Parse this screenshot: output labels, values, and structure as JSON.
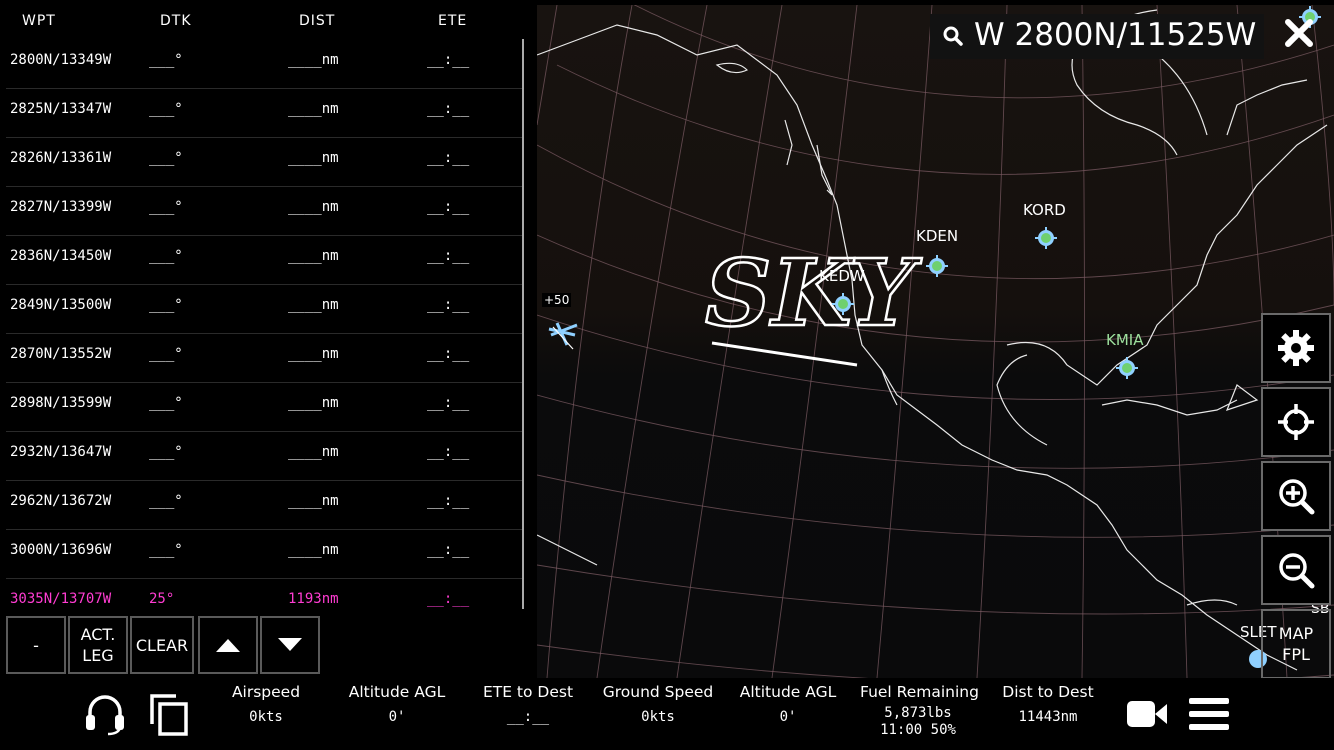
{
  "flight_plan": {
    "headers": {
      "wpt": "WPT",
      "dtk": "DTK",
      "dist": "DIST",
      "ete": "ETE"
    },
    "rows": [
      {
        "wpt": "2800N/13349W",
        "dtk": "___°",
        "dist": "____nm",
        "ete": "__:__"
      },
      {
        "wpt": "2825N/13347W",
        "dtk": "___°",
        "dist": "____nm",
        "ete": "__:__"
      },
      {
        "wpt": "2826N/13361W",
        "dtk": "___°",
        "dist": "____nm",
        "ete": "__:__"
      },
      {
        "wpt": "2827N/13399W",
        "dtk": "___°",
        "dist": "____nm",
        "ete": "__:__"
      },
      {
        "wpt": "2836N/13450W",
        "dtk": "___°",
        "dist": "____nm",
        "ete": "__:__"
      },
      {
        "wpt": "2849N/13500W",
        "dtk": "___°",
        "dist": "____nm",
        "ete": "__:__"
      },
      {
        "wpt": "2870N/13552W",
        "dtk": "___°",
        "dist": "____nm",
        "ete": "__:__"
      },
      {
        "wpt": "2898N/13599W",
        "dtk": "___°",
        "dist": "____nm",
        "ete": "__:__"
      },
      {
        "wpt": "2932N/13647W",
        "dtk": "___°",
        "dist": "____nm",
        "ete": "__:__"
      },
      {
        "wpt": "2962N/13672W",
        "dtk": "___°",
        "dist": "____nm",
        "ete": "__:__"
      },
      {
        "wpt": "3000N/13696W",
        "dtk": "___°",
        "dist": "____nm",
        "ete": "__:__"
      },
      {
        "wpt": "3035N/13707W",
        "dtk": "25°",
        "dist": "1193nm",
        "ete": "__:__"
      }
    ],
    "active_color": "#ff3cd2",
    "buttons": {
      "minus": "-",
      "act_leg_1": "ACT.",
      "act_leg_2": "LEG",
      "clear": "CLEAR",
      "up_icon": "triangle-up-icon",
      "down_icon": "triangle-down-icon"
    }
  },
  "map": {
    "search_text": "W 2800N/11525W",
    "airports": {
      "kden": "KDEN",
      "kord": "KORD",
      "kmia": "KMIA",
      "kedw": "KEDW",
      "slet": "SLET",
      "sb": "SB"
    },
    "aircraft_label": "+50",
    "marker_color": "#8fd0ff",
    "kmia_color": "#9de09d",
    "watermark": "SKY"
  },
  "side_buttons": {
    "settings_icon": "gear-icon",
    "center_icon": "crosshair-icon",
    "zoom_in_icon": "zoom-in-icon",
    "zoom_out_icon": "zoom-out-icon",
    "map_label": "MAP",
    "fpl_label": "FPL"
  },
  "bottom_bar": {
    "airspeed": {
      "label": "Airspeed",
      "value": "0kts"
    },
    "altitude_agl_1": {
      "label": "Altitude AGL",
      "value": "0'"
    },
    "ete_to_dest": {
      "label": "ETE to Dest",
      "value": "__:__"
    },
    "ground_speed": {
      "label": "Ground Speed",
      "value": "0kts"
    },
    "altitude_agl_2": {
      "label": "Altitude AGL",
      "value": "0'"
    },
    "fuel_remaining": {
      "label": "Fuel Remaining",
      "value_1": "5,873lbs",
      "value_2": "11:00 50%"
    },
    "dist_to_dest": {
      "label": "Dist to Dest",
      "value": "11443nm"
    }
  }
}
